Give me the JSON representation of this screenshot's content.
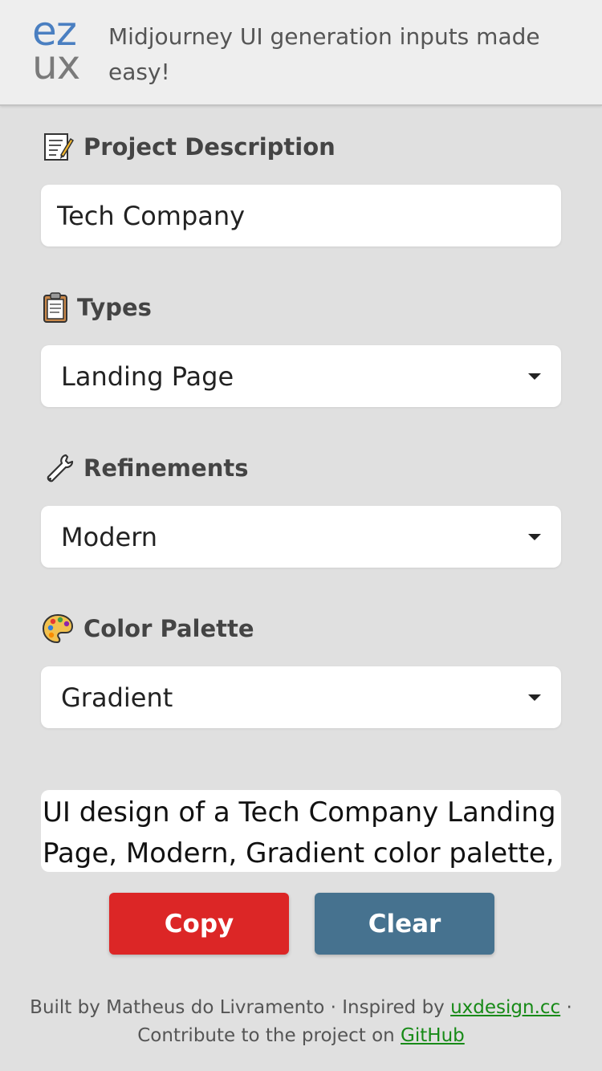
{
  "header": {
    "logo_top": "ez",
    "logo_bottom": "ux",
    "tagline": "Midjourney UI generation inputs made easy!"
  },
  "project": {
    "label": "Project Description",
    "icon": "memo-icon",
    "value": "Tech Company"
  },
  "types": {
    "label": "Types",
    "icon": "clipboard-icon",
    "selected": "Landing Page"
  },
  "refinements": {
    "label": "Refinements",
    "icon": "wrench-icon",
    "selected": "Modern"
  },
  "palette": {
    "label": "Color Palette",
    "icon": "palette-icon",
    "selected": "Gradient"
  },
  "output": {
    "text": "UI design of a Tech Company Landing Page, Modern, Gradient color palette,"
  },
  "buttons": {
    "copy": "Copy",
    "clear": "Clear"
  },
  "footer": {
    "built_by": "Built by Matheus do Livramento · Inspired by ",
    "inspired_link": "uxdesign.cc",
    "sep": " ·",
    "contribute": "Contribute to the project on ",
    "github_link": "GitHub"
  },
  "colors": {
    "background": "#e0e0e0",
    "copy_button": "#dc2626",
    "clear_button": "#46728f",
    "logo_blue": "#4a7fc1",
    "link": "#178a17"
  }
}
